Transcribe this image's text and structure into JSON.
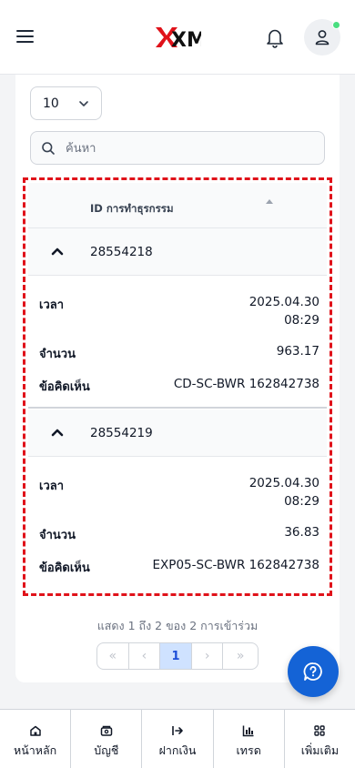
{
  "header": {
    "brand": "XM",
    "brand_color": "#e0121a"
  },
  "table_controls": {
    "page_size": "10",
    "search_placeholder": "ค้นหา"
  },
  "table": {
    "column_header": "ID การทำธุรกรรม",
    "label_time": "เวลา",
    "label_amount": "จำนวน",
    "label_comment": "ข้อคิดเห็น",
    "rows": [
      {
        "id": "28554218",
        "date": "2025.04.30",
        "time": "08:29",
        "amount": "963.17",
        "comment": "CD-SC-BWR 162842738"
      },
      {
        "id": "28554219",
        "date": "2025.04.30",
        "time": "08:29",
        "amount": "36.83",
        "comment": "EXP05-SC-BWR 162842738"
      }
    ]
  },
  "pagination": {
    "info": "แสดง 1 ถึง 2 ของ 2 การเข้าร่วม",
    "current_page": "1",
    "first": "«",
    "prev": "‹",
    "next": "›",
    "last": "»"
  },
  "bottom_nav": {
    "home": "หน้าหลัก",
    "accounts": "บัญชี",
    "deposit": "ฝากเงิน",
    "trade": "เทรด",
    "more": "เพิ่มเติม"
  },
  "icons": [
    "menu-icon",
    "bell-icon",
    "user-icon",
    "chevron-down-icon",
    "search-icon",
    "chevron-up-icon",
    "help-chat-icon",
    "home-icon",
    "wallet-icon",
    "deposit-icon",
    "chart-icon",
    "grid-icon"
  ]
}
